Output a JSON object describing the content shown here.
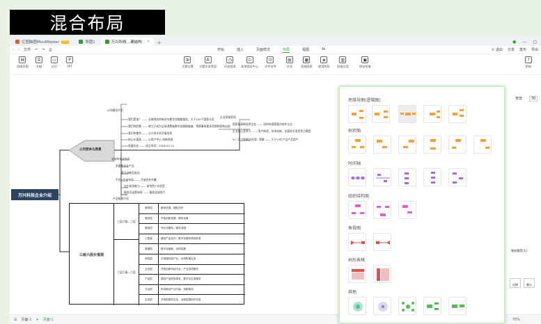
{
  "banner": {
    "title": "混合布局"
  },
  "tabs": [
    {
      "label": "亿图脑图MindMaster",
      "badge": "Pro",
      "color": "#e85a3c"
    },
    {
      "label": "导图1",
      "color": "#3a9a3a"
    },
    {
      "label": "万兴科技…建结构",
      "color": "#3a9a3a"
    }
  ],
  "window": {
    "plus": "+"
  },
  "menu": {
    "file": "文件",
    "items": [
      "开始",
      "插入",
      "页面样式",
      "布局",
      "视图",
      "AI"
    ],
    "active_index": 3,
    "right": [
      "① 退出",
      "分享",
      "发布",
      "导出"
    ]
  },
  "toolbar": {
    "left": [
      "思维导图",
      "大纲",
      "幻灯",
      "PPT"
    ],
    "center": [
      "主题位置",
      "主题文本宽度",
      "历史版本",
      "本地保存中心",
      "文件合并",
      "任务",
      "思维图表",
      "使用图形",
      "思维文案",
      "保存检查"
    ],
    "right": "帮助"
  },
  "mindmap": {
    "root": "万兴科技企业介绍",
    "branch1": "公司使命与愿景",
    "branch2": "三级六层价值观",
    "top_label": "公司概况介绍",
    "lines_top": [
      "我们是谁？ —— 全球领先的新创与数字化赋能服务，大于150个国家公司",
      "我们的愿景 —— 致力于成为全球消费者数字创意赋能者，将赛事有更多思想和家和自由",
      "我们的使命 —— 让众多业务开展信息",
      "核心价值观 —— 以用户中心 创新改变",
      "发展历史 —— 成立时间：2008.04.12"
    ],
    "lines_right": [
      "企业荣誉奖项",
      "国家级高新技术企业 —— 深圳市国家重点软件企业",
      "企业核心竞争力 —— 用户体验，技术创新，全面的开发竞争力模型",
      "AI（人工智能及应用）领域 —— 大于15亿产品产品用户"
    ],
    "lines_mid": [
      "全球市场化布局",
      "多重数字化产品",
      "重大创新型驱动",
      "平台+生态布局 —— 开放合作共赢",
      "自主研发能力 —— 研究院+实验室",
      "服务及运营体系 —— 服务全球用户",
      "产品矩阵介绍"
    ],
    "table_groups": [
      "三层六级—三层",
      "三层六级—六层"
    ],
    "table_left": [
      "服务层",
      "服务层",
      "服务层",
      "六层级",
      "数据层",
      "科技层",
      "企业层",
      "产品层",
      "平台层",
      "生态层"
    ],
    "table_right": [
      "服务全国，团队协作",
      "开放创新发展，服务全局",
      "专业化服务，服务全国",
      "建设产品合作，数字化服务体验标准",
      "数字化赋能，全球发展",
      "引领高科技产业，全球布局生态",
      "开放创新科技平台，产业全球服务",
      "建设产品研发体系，数字化生态服务",
      "科技驱动产业升级，创新驱动",
      "开放型服务生态，全面发展协作共赢"
    ]
  },
  "layout_popup": {
    "sections": [
      "思维导图(逻辑图)",
      "树状图",
      "时间轴",
      "组织结构图",
      "鱼骨图",
      "树形表格",
      "其他"
    ],
    "colors": {
      "orange": "#f5a030",
      "purple": "#a06ce0",
      "pink": "#e060d0",
      "red": "#e05050",
      "green": "#50c050",
      "gray": "#d0d0d0"
    }
  },
  "right_panel": {
    "size_label": "宽度",
    "size_value": "30",
    "font_label": "微软雅黑(大)",
    "btns": [
      "迁移",
      "重分"
    ]
  },
  "status": {
    "page": "页面-1",
    "page_tab": "页面-1",
    "zoom": "70%"
  }
}
